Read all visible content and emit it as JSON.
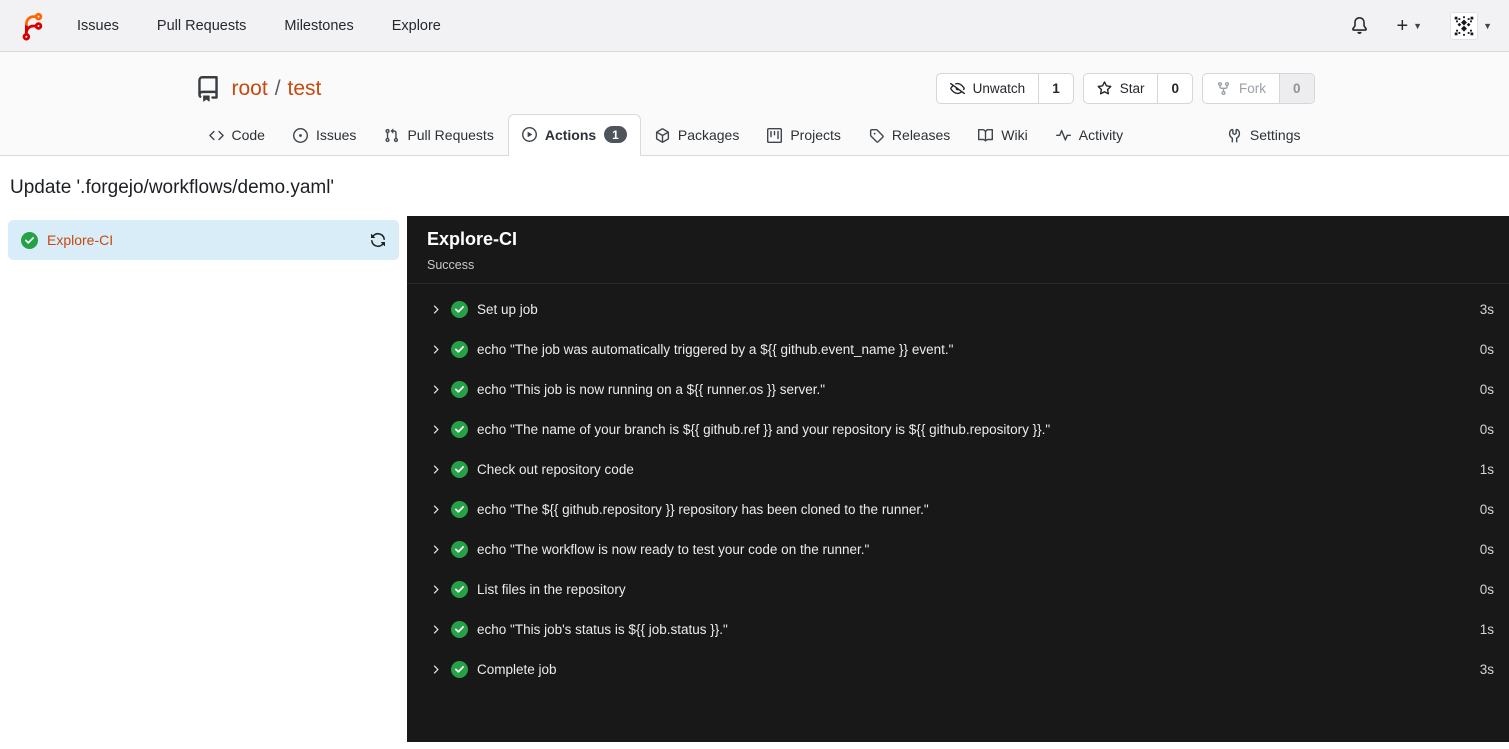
{
  "colors": {
    "accent_link": "#c7490f",
    "logo_orange": "#ff6600",
    "logo_red": "#d40000",
    "success_green": "#26a148",
    "selected_job_bg": "#d9edf9",
    "log_panel_bg": "#181818",
    "tab_badge_bg": "#4e545b"
  },
  "navbar": {
    "items": [
      "Issues",
      "Pull Requests",
      "Milestones",
      "Explore"
    ]
  },
  "repo": {
    "owner": "root",
    "separator": "/",
    "name": "test"
  },
  "repo_buttons": {
    "unwatch": {
      "label": "Unwatch",
      "count": "1"
    },
    "star": {
      "label": "Star",
      "count": "0"
    },
    "fork": {
      "label": "Fork",
      "count": "0"
    }
  },
  "tabs": [
    {
      "label": "Code"
    },
    {
      "label": "Issues"
    },
    {
      "label": "Pull Requests"
    },
    {
      "label": "Actions",
      "badge": "1",
      "active": true
    },
    {
      "label": "Packages"
    },
    {
      "label": "Projects"
    },
    {
      "label": "Releases"
    },
    {
      "label": "Wiki"
    },
    {
      "label": "Activity"
    },
    {
      "label": "Settings"
    }
  ],
  "page": {
    "title": "Update '.forgejo/workflows/demo.yaml'"
  },
  "run": {
    "job_name": "Explore-CI",
    "panel_title": "Explore-CI",
    "status": "Success",
    "steps": [
      {
        "name": "Set up job",
        "duration": "3s"
      },
      {
        "name": "echo \"The job was automatically triggered by a ${{ github.event_name }} event.\"",
        "duration": "0s"
      },
      {
        "name": "echo \"This job is now running on a ${{ runner.os }} server.\"",
        "duration": "0s"
      },
      {
        "name": "echo \"The name of your branch is ${{ github.ref }} and your repository is ${{ github.repository }}.\"",
        "duration": "0s"
      },
      {
        "name": "Check out repository code",
        "duration": "1s"
      },
      {
        "name": "echo \"The ${{ github.repository }} repository has been cloned to the runner.\"",
        "duration": "0s"
      },
      {
        "name": "echo \"The workflow is now ready to test your code on the runner.\"",
        "duration": "0s"
      },
      {
        "name": "List files in the repository",
        "duration": "0s"
      },
      {
        "name": "echo \"This job's status is ${{ job.status }}.\"",
        "duration": "1s"
      },
      {
        "name": "Complete job",
        "duration": "3s"
      }
    ]
  }
}
